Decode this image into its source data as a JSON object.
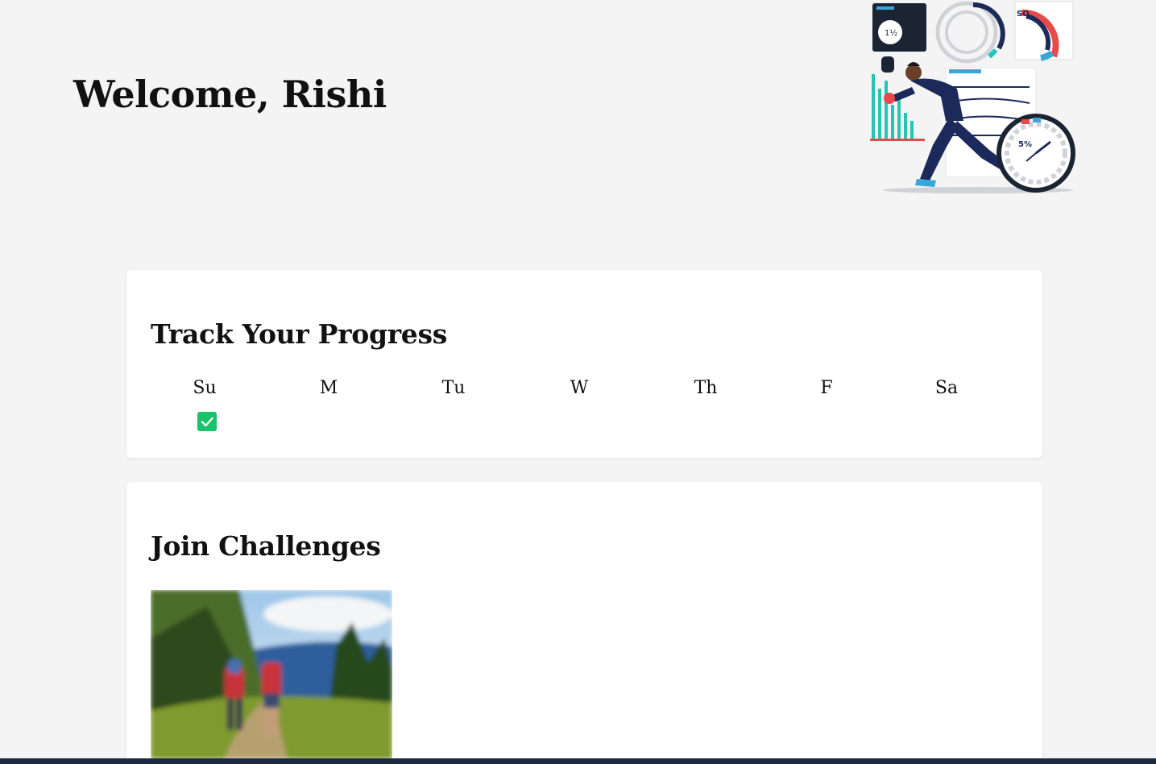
{
  "header": {
    "welcome": "Welcome, Rishi",
    "hero_icon": "fitness-runner-illustration-icon"
  },
  "progress": {
    "title": "Track Your Progress",
    "days": [
      {
        "label": "Su",
        "checked": true
      },
      {
        "label": "M",
        "checked": false
      },
      {
        "label": "Tu",
        "checked": false
      },
      {
        "label": "W",
        "checked": false
      },
      {
        "label": "Th",
        "checked": false
      },
      {
        "label": "F",
        "checked": false
      },
      {
        "label": "Sa",
        "checked": false
      }
    ],
    "check_color": "#19c26b"
  },
  "challenges": {
    "title": "Join Challenges",
    "items": [
      {
        "image_icon": "hikers-trail-image-icon"
      }
    ]
  }
}
